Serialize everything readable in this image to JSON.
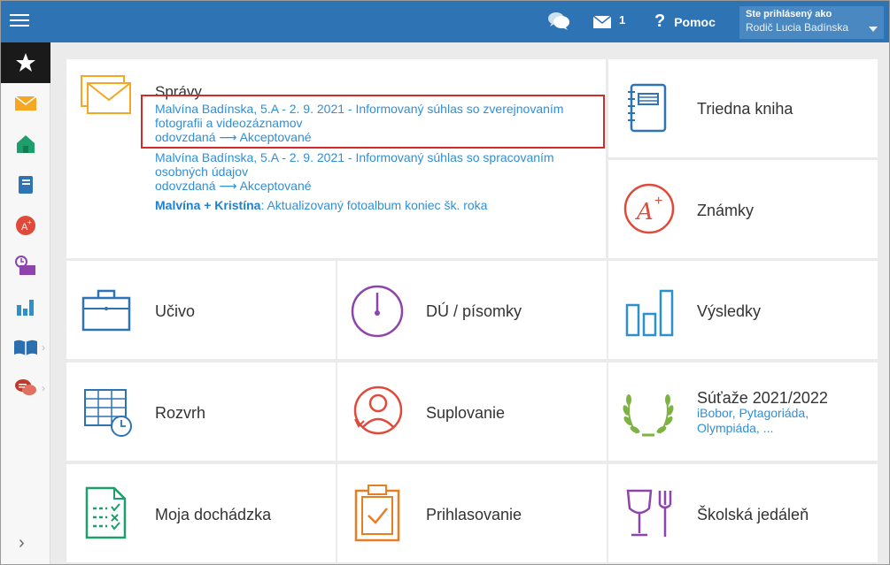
{
  "topbar": {
    "mail_count": "1",
    "help_label": "Pomoc",
    "user_line1": "Ste prihlásený ako",
    "user_line2": "Rodič Lucia Badínska",
    "accent": "#2e74b5"
  },
  "sidebar": {
    "items": [
      {
        "name": "favorites",
        "icon": "star-icon"
      },
      {
        "name": "messages",
        "icon": "envelope-icon"
      },
      {
        "name": "home",
        "icon": "house-icon"
      },
      {
        "name": "class-book",
        "icon": "notebook-icon"
      },
      {
        "name": "grades",
        "icon": "grade-icon"
      },
      {
        "name": "attendance",
        "icon": "clock-screen-icon"
      },
      {
        "name": "results",
        "icon": "bar-chart-icon"
      },
      {
        "name": "library",
        "icon": "open-book-icon"
      },
      {
        "name": "chat",
        "icon": "chat-icon"
      }
    ],
    "expand": "›"
  },
  "spravy": {
    "title": "Správy",
    "messages": [
      {
        "text": "Malvína Badínska, 5.A - 2. 9. 2021 - Informovaný súhlas so zverejnovaním fotografii a videozáznamov",
        "status": "odovzdaná ⟶ Akceptované"
      },
      {
        "text": "Malvína Badínska, 5.A - 2. 9. 2021 - Informovaný súhlas so spracovaním osobných údajov",
        "status": "odovzdaná ⟶ Akceptované"
      }
    ],
    "album_bold": "Malvína + Kristína",
    "album_rest": ": Aktualizovaný fotoalbum koniec šk. roka"
  },
  "tiles": {
    "triedna_kniha": "Triedna kniha",
    "znamky": "Známky",
    "ucivo": "Učivo",
    "du_pisomky": "DÚ / písomky",
    "vysledky": "Výsledky",
    "rozvrh": "Rozvrh",
    "suplovanie": "Suplovanie",
    "sutaze": "Súťaže 2021/2022",
    "sutaze_sub1": "iBobor, Pytagoriáda,",
    "sutaze_sub2": "Olympiáda, ...",
    "dochadzka": "Moja dochádzka",
    "prihlasovanie": "Prihlasovanie",
    "jedalen": "Školská jedáleň"
  }
}
